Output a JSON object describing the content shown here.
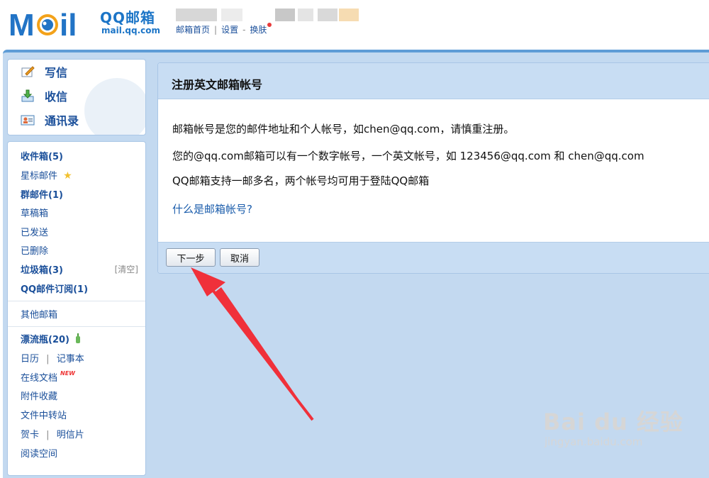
{
  "header": {
    "logo_text": "MAIL",
    "logo_cn": "QQ邮箱",
    "logo_url": "mail.qq.com",
    "links": [
      {
        "label": "邮箱首页"
      },
      {
        "label": "设置"
      },
      {
        "label": "换肤"
      }
    ],
    "separators": [
      "|",
      "-"
    ]
  },
  "quick_actions": [
    {
      "label": "写信",
      "icon": "compose-icon"
    },
    {
      "label": "收信",
      "icon": "inbox-download-icon"
    },
    {
      "label": "通讯录",
      "icon": "contacts-icon"
    }
  ],
  "folders": {
    "inbox": "收件箱(5)",
    "starred": "星标邮件",
    "group": "群邮件(1)",
    "drafts": "草稿箱",
    "sent": "已发送",
    "deleted": "已删除",
    "spam": "垃圾箱(3)",
    "spam_clear": "[清空]",
    "subscription": "QQ邮件订阅(1)",
    "other": "其他邮箱",
    "bottle": "漂流瓶(20)",
    "calendar": "日历",
    "notes": "记事本",
    "docs": "在线文档",
    "docs_badge": "NEW",
    "attachments": "附件收藏",
    "transfer": "文件中转站",
    "cards": "贺卡",
    "postcards": "明信片",
    "reading": "阅读空间"
  },
  "panel": {
    "title": "注册英文邮箱帐号",
    "line1": "邮箱帐号是您的邮件地址和个人帐号，如chen@qq.com，请慎重注册。",
    "line2": "您的@qq.com邮箱可以有一个数字帐号，一个英文帐号，如 123456@qq.com 和 chen@qq.com",
    "line3": "QQ邮箱支持一邮多名，两个帐号均可用于登陆QQ邮箱",
    "help_link": "什么是邮箱帐号?",
    "next_button": "下一步",
    "cancel_button": "取消"
  },
  "watermark": {
    "main": "Bai du 经验",
    "sub": "jingyan.baidu.com"
  },
  "colors": {
    "accent": "#1a4f9a",
    "panel_header": "#c8ddf3",
    "annotation_arrow": "#f0303a"
  }
}
